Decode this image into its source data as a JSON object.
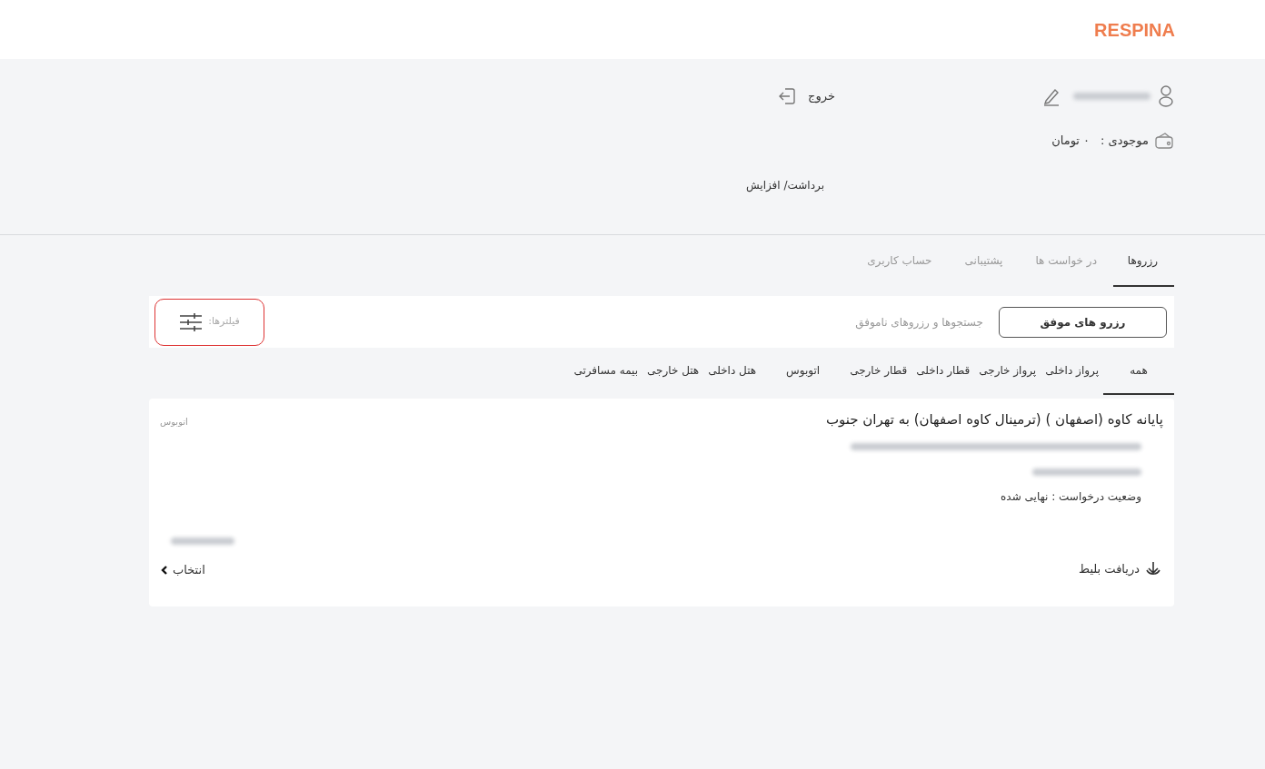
{
  "header": {
    "logo": "RESPINA"
  },
  "account": {
    "logout": "خروج",
    "balance_label": "موجودی :",
    "balance_value": "۰ تومان",
    "wallet_link": "برداشت/ افزایش"
  },
  "tabs": [
    {
      "label": "رزروها",
      "selected": true
    },
    {
      "label": "در خواست ها",
      "selected": false
    },
    {
      "label": "پشتیبانی",
      "selected": false
    },
    {
      "label": "حساب کاربری",
      "selected": false
    }
  ],
  "segments": [
    {
      "label": "رزرو های موفق",
      "selected": true
    },
    {
      "label": "جستجوها و رزروهای ناموفق",
      "selected": false
    }
  ],
  "filters": {
    "label": "فیلترها:"
  },
  "categories": [
    {
      "label": "همه",
      "selected": true
    },
    {
      "label": "پرواز داخلی",
      "selected": false
    },
    {
      "label": "پرواز خارجی",
      "selected": false
    },
    {
      "label": "قطار داخلی",
      "selected": false
    },
    {
      "label": "قطار خارجی",
      "selected": false
    },
    {
      "label": "اتوبوس",
      "selected": false
    },
    {
      "label": "هتل داخلی",
      "selected": false
    },
    {
      "label": "هتل خارجی",
      "selected": false
    },
    {
      "label": "بیمه مسافرتی",
      "selected": false
    }
  ],
  "reservation": {
    "title": "پایانه کاوه (اصفهان ) (ترمینال کاوه اصفهان) به تهران جنوب",
    "type": "اتوبوس",
    "status": "وضعیت درخواست : نهایی شده",
    "download": "دریافت بلیط",
    "select": "انتخاب"
  }
}
